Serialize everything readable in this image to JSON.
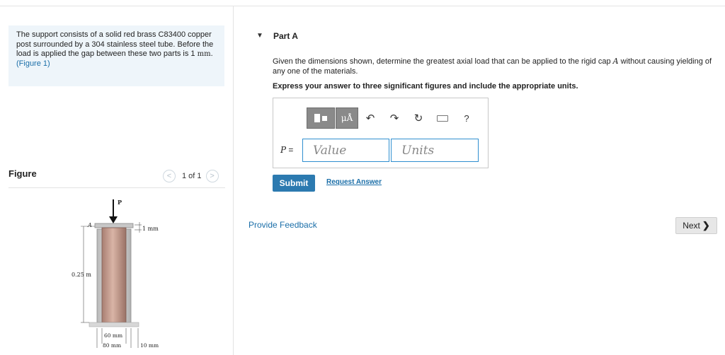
{
  "problem": {
    "statement": "The support consists of a solid red brass C83400 copper post surrounded by a 304 stainless steel tube. Before the load is applied the gap between these two parts is 1",
    "unit": "mm",
    "period": ".",
    "figure_link": "(Figure 1)"
  },
  "figure": {
    "title": "Figure",
    "pager": "1 of 1",
    "labels": {
      "load": "P",
      "cap": "A",
      "gap": "1 mm",
      "height": "0.25 m",
      "inner_diameter": "60 mm",
      "outer_diameter": "80 mm",
      "thickness": "10 mm"
    }
  },
  "part": {
    "title": "Part A",
    "question_pre": "Given the dimensions shown, determine the greatest axial load that can be applied to the rigid cap ",
    "question_var": "A",
    "question_post": " without causing yielding of any one of the materials.",
    "instruction": "Express your answer to three significant figures and include the appropriate units."
  },
  "answer": {
    "toolbar": {
      "units_label": "μÅ",
      "undo_icon": "↶",
      "redo_icon": "↷",
      "reset_icon": "↻",
      "help_icon": "?"
    },
    "var_label": "P",
    "equals": " =",
    "value_placeholder": "Value",
    "units_placeholder": "Units"
  },
  "actions": {
    "submit": "Submit",
    "request_answer": "Request Answer",
    "feedback": "Provide Feedback",
    "next": "Next",
    "next_chevron": "❯"
  },
  "colors": {
    "link": "#1a6ea8",
    "submit_bg": "#2c7ab0",
    "input_border": "#2f8fd0",
    "problem_bg": "#eef5fa",
    "post": "#c9a095",
    "tube": "#d8d8d8"
  }
}
